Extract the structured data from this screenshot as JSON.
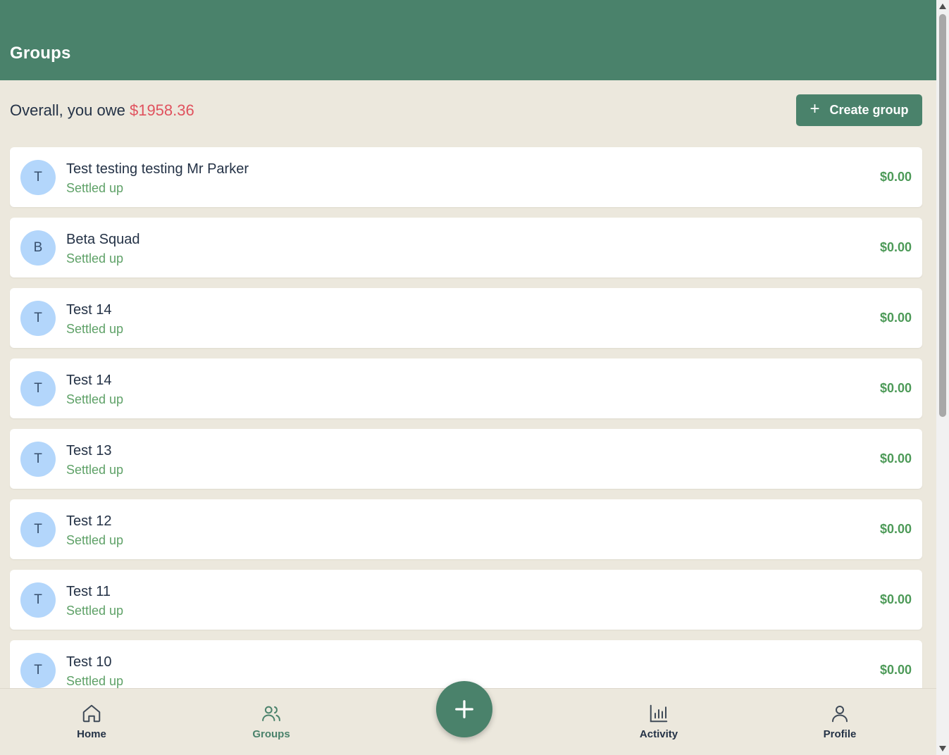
{
  "header": {
    "title": "Groups"
  },
  "summary": {
    "prefix": "Overall, you owe ",
    "amount": "$1958.36",
    "amount_color": "#e0525e"
  },
  "create_button": {
    "icon": "plus-icon",
    "label": "Create group"
  },
  "groups": [
    {
      "initial": "T",
      "name": "Test testing testing Mr Parker",
      "status": "Settled up",
      "balance": "$0.00"
    },
    {
      "initial": "B",
      "name": "Beta Squad",
      "status": "Settled up",
      "balance": "$0.00"
    },
    {
      "initial": "T",
      "name": "Test 14",
      "status": "Settled up",
      "balance": "$0.00"
    },
    {
      "initial": "T",
      "name": "Test 14",
      "status": "Settled up",
      "balance": "$0.00"
    },
    {
      "initial": "T",
      "name": "Test 13",
      "status": "Settled up",
      "balance": "$0.00"
    },
    {
      "initial": "T",
      "name": "Test 12",
      "status": "Settled up",
      "balance": "$0.00"
    },
    {
      "initial": "T",
      "name": "Test 11",
      "status": "Settled up",
      "balance": "$0.00"
    },
    {
      "initial": "T",
      "name": "Test 10",
      "status": "Settled up",
      "balance": "$0.00"
    }
  ],
  "nav": {
    "home": {
      "label": "Home",
      "icon": "home-icon"
    },
    "groups": {
      "label": "Groups",
      "icon": "users-icon"
    },
    "add": {
      "icon": "plus-icon"
    },
    "activity": {
      "label": "Activity",
      "icon": "bar-chart-icon"
    },
    "profile": {
      "label": "Profile",
      "icon": "user-icon"
    }
  },
  "colors": {
    "brand": "#4a826b",
    "background": "#ece8dd",
    "settled": "#5ea167",
    "avatar": "#b3d6fb"
  }
}
